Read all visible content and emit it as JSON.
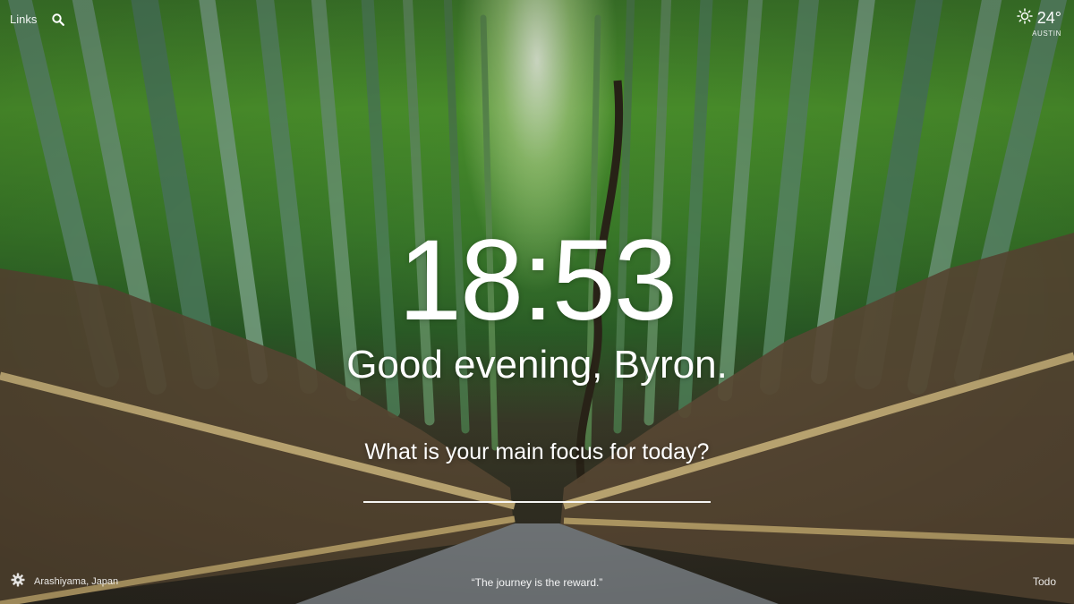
{
  "top_left": {
    "links_label": "Links"
  },
  "weather": {
    "temperature": "24°",
    "location": "AUSTIN"
  },
  "clock": {
    "time": "18:53"
  },
  "greeting": {
    "text": "Good evening, Byron."
  },
  "focus": {
    "question": "What is your main focus for today?",
    "value": ""
  },
  "bottom": {
    "photo_location": "Arashiyama, Japan",
    "quote": "“The journey is the reward.”",
    "todo_label": "Todo"
  },
  "icons": {
    "search": "search-icon",
    "weather": "sun-icon",
    "settings": "gear-icon"
  }
}
